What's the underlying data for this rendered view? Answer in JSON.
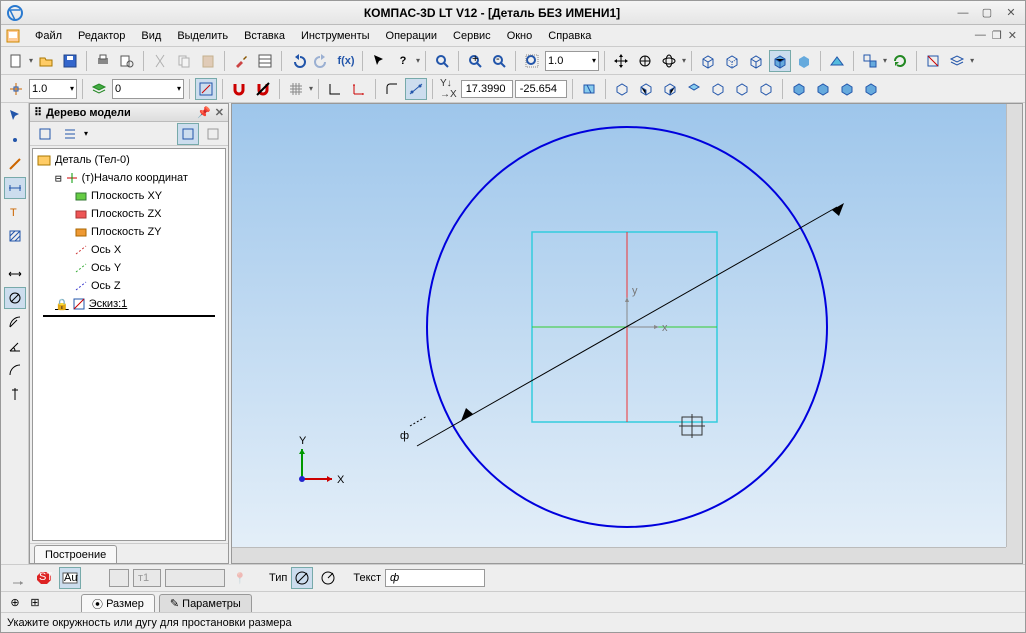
{
  "window": {
    "title": "КОМПАС-3D LT V12 - [Деталь БЕЗ ИМЕНИ1]"
  },
  "menu": {
    "file": "Файл",
    "editor": "Редактор",
    "view": "Вид",
    "select": "Выделить",
    "insert": "Вставка",
    "tools": "Инструменты",
    "operations": "Операции",
    "service": "Сервис",
    "window": "Окно",
    "help": "Справка"
  },
  "toolbar1": {
    "line_style": "1.0",
    "zoom_value": "1.0"
  },
  "toolbar2": {
    "step": "1.0",
    "offset": "0",
    "coord_x": "17.3990",
    "coord_y": "-25.654"
  },
  "tree": {
    "title": "Дерево модели",
    "root": "Деталь (Тел-0)",
    "origin": "(т)Начало координат",
    "plane_xy": "Плоскость XY",
    "plane_zx": "Плоскость ZX",
    "plane_zy": "Плоскость ZY",
    "axis_x": "Ось X",
    "axis_y": "Ось Y",
    "axis_z": "Ось Z",
    "sketch": "Эскиз:1",
    "tab": "Построение"
  },
  "viewport": {
    "x_label": "X",
    "y_label": "Y",
    "phi": "ф",
    "axis_x_small": "x",
    "axis_y_small": "y"
  },
  "bottom": {
    "t1": "т1",
    "type": "Тип",
    "text_label": "Текст",
    "text_value": "ф",
    "tab_size": "Размер",
    "tab_params": "Параметры"
  },
  "status": {
    "msg": "Укажите окружность или дугу для простановки размера"
  }
}
